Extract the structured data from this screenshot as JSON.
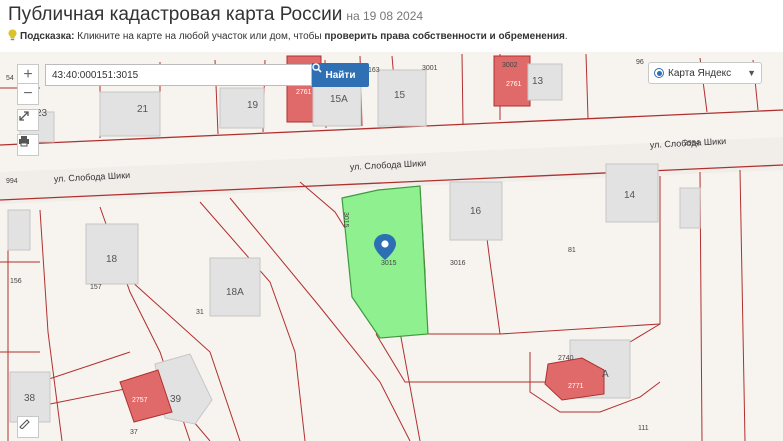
{
  "header": {
    "title": "Публичная кадастровая карта России",
    "date": "на 19 08 2024",
    "hint_label": "Подсказка:",
    "hint_text": " Кликните на карте на любой участок или дом, чтобы ",
    "hint_bold": "проверить права собственности и обременения",
    "hint_end": "."
  },
  "search": {
    "value": "43:40:000151:3015",
    "button_label": "Найти"
  },
  "layer": {
    "selected": "Карта Яндекс"
  },
  "controls": {
    "zoom_in": "+",
    "zoom_out": "−"
  },
  "map": {
    "streets": [
      "ул. Слобода Шики",
      "ул. Слобода Шики"
    ],
    "house_numbers": [
      "21",
      "19",
      "15А",
      "15",
      "13",
      "23",
      "16",
      "14",
      "18",
      "18А",
      "39",
      "38",
      "А"
    ],
    "parcel_numbers": [
      "163",
      "3001",
      "3002",
      "2761",
      "2761",
      "96",
      "54",
      "3015",
      "3015",
      "3016",
      "81",
      "157",
      "156",
      "31",
      "37",
      "2740",
      "2757",
      "2771",
      "111",
      "2994",
      "994"
    ],
    "selected_parcel_color": "#8ff08f",
    "building_color": "#e06a6a",
    "boundary_color": "#b03030"
  }
}
